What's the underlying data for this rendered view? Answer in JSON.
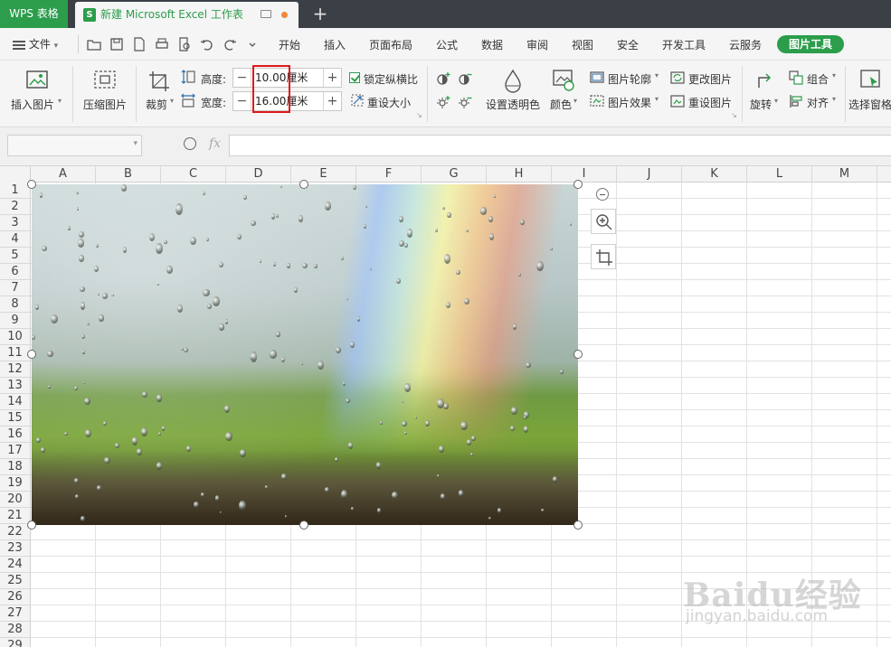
{
  "titlebar": {
    "app_name": "WPS 表格",
    "doc_tab_icon": "S",
    "doc_title": "新建 Microsoft Excel 工作表",
    "new_tab_symbol": "+"
  },
  "menubar": {
    "file_label": "文件",
    "file_arrow": "▾",
    "items": [
      "开始",
      "插入",
      "页面布局",
      "公式",
      "数据",
      "审阅",
      "视图",
      "安全",
      "开发工具",
      "云服务",
      "图片工具"
    ],
    "active_item": "图片工具"
  },
  "ribbon": {
    "insert_picture": "插入图片",
    "compress_picture": "压缩图片",
    "crop": "裁剪",
    "height_label": "高度:",
    "width_label": "宽度:",
    "height_value": "10.00厘米",
    "width_value": "16.00厘米",
    "lock_ratio": "锁定纵横比",
    "reset_size": "重设大小",
    "set_transparent": "设置透明色",
    "color": "颜色",
    "picture_outline": "图片轮廓",
    "picture_effect": "图片效果",
    "change_picture": "更改图片",
    "reset_picture": "重设图片",
    "rotate": "旋转",
    "group": "组合",
    "align": "对齐",
    "selection_pane": "选择窗格"
  },
  "formulabar": {
    "fx": "fx"
  },
  "grid": {
    "columns": [
      "A",
      "B",
      "C",
      "D",
      "E",
      "F",
      "G",
      "H",
      "I",
      "J",
      "K",
      "L",
      "M"
    ],
    "rows": [
      "1",
      "2",
      "3",
      "4",
      "5",
      "6",
      "7",
      "8",
      "9",
      "10",
      "11",
      "12",
      "13",
      "14",
      "15",
      "16",
      "17",
      "18",
      "19",
      "20",
      "21",
      "22",
      "23",
      "24",
      "25",
      "26",
      "27",
      "28",
      "29"
    ]
  },
  "watermark": {
    "brand": "Baidu经验",
    "url": "jingyan.baidu.com"
  },
  "colors": {
    "accent": "#2b9d4b",
    "titlebar": "#3b3f46",
    "highlight": "#e0181c"
  }
}
